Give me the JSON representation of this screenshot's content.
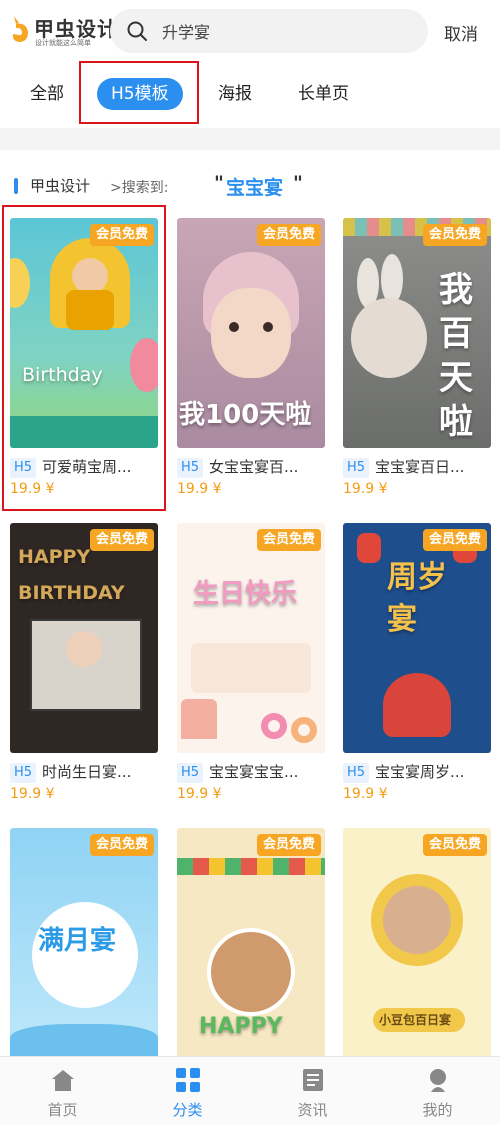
{
  "header": {
    "logo_name": "甲虫设计",
    "logo_slogan": "设计就能这么简单",
    "search_value": "升学宴",
    "cancel_label": "取消"
  },
  "tabs": [
    {
      "label": "全部",
      "active": false
    },
    {
      "label": "H5模板",
      "active": true
    },
    {
      "label": "海报",
      "active": false
    },
    {
      "label": "长单页",
      "active": false
    }
  ],
  "breadcrumb": {
    "brand": "甲虫设计",
    "separator": ">搜索到:",
    "open_quote": "\"",
    "keyword": "宝宝宴",
    "close_quote": "\""
  },
  "badge_label": "会员免费",
  "cards": [
    {
      "tag": "H5",
      "title": "可爱萌宝周...",
      "price": "19.9 ¥",
      "art_text": "Birthday"
    },
    {
      "tag": "H5",
      "title": "女宝宝宴百...",
      "price": "19.9 ¥",
      "art_text": "我100天啦"
    },
    {
      "tag": "H5",
      "title": "宝宝宴百日...",
      "price": "19.9 ¥",
      "art_text": "我百天啦"
    },
    {
      "tag": "H5",
      "title": "时尚生日宴...",
      "price": "19.9 ¥",
      "art_text": "HAPPY BIRTHDAY"
    },
    {
      "tag": "H5",
      "title": "宝宝宴宝宝...",
      "price": "19.9 ¥",
      "art_text": "生日快乐"
    },
    {
      "tag": "H5",
      "title": "宝宝宴周岁...",
      "price": "19.9 ¥",
      "art_text": "周岁宴"
    },
    {
      "tag": "",
      "title": "",
      "price": "",
      "art_text": "满月宴"
    },
    {
      "tag": "",
      "title": "",
      "price": "",
      "art_text": "HAPPY"
    },
    {
      "tag": "",
      "title": "",
      "price": "",
      "art_text": "小豆包百日宴"
    }
  ],
  "nav": [
    {
      "label": "首页",
      "icon": "home-icon",
      "active": false
    },
    {
      "label": "分类",
      "icon": "category-grid-icon",
      "active": true
    },
    {
      "label": "资讯",
      "icon": "news-icon",
      "active": false
    },
    {
      "label": "我的",
      "icon": "profile-icon",
      "active": false
    }
  ],
  "colors": {
    "accent": "#2b8ff0",
    "badge": "#f6a623",
    "price": "#f39c12",
    "highlight": "#d9151b"
  }
}
